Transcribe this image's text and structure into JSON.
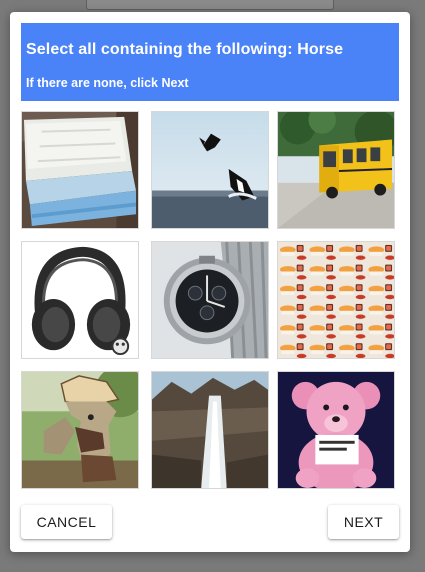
{
  "challenge": {
    "title": "Select all containing the following: Horse",
    "subtitle": "If there are none, click Next"
  },
  "tiles": [
    {
      "subject": "mattress"
    },
    {
      "subject": "orca-breaching"
    },
    {
      "subject": "school-bus"
    },
    {
      "subject": "headphones"
    },
    {
      "subject": "wristwatch"
    },
    {
      "subject": "sushi-pattern"
    },
    {
      "subject": "horse-statue"
    },
    {
      "subject": "waterfall"
    },
    {
      "subject": "pink-teddy-bear"
    }
  ],
  "buttons": {
    "cancel": "CANCEL",
    "next": "NEXT"
  },
  "colors": {
    "header": "#4a82f7",
    "overlay": "#7a7a7a"
  }
}
